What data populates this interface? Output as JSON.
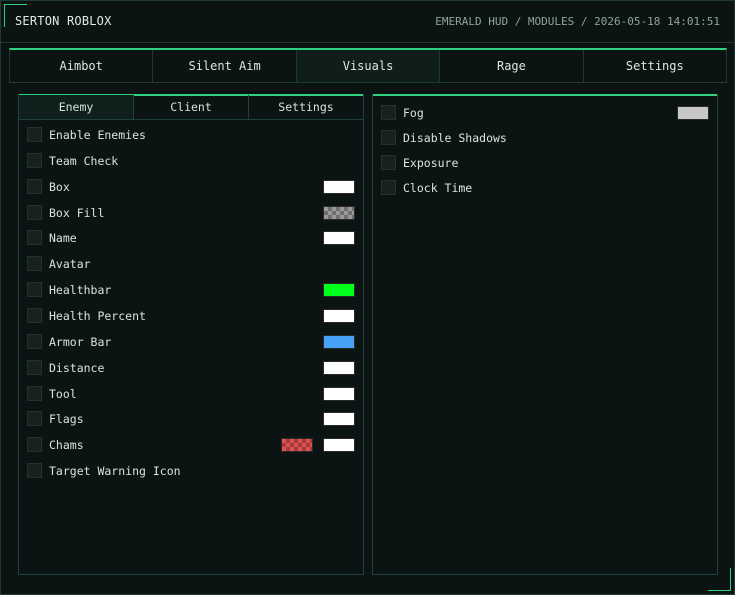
{
  "app": {
    "title": "SERTON ROBLOX",
    "breadcrumb": "EMERALD HUD / MODULES / 2026-05-18 14:01:51"
  },
  "main_tabs": [
    {
      "label": "Aimbot"
    },
    {
      "label": "Silent Aim"
    },
    {
      "label": "Visuals",
      "active": true
    },
    {
      "label": "Rage"
    },
    {
      "label": "Settings"
    }
  ],
  "left_panel": {
    "subtabs": [
      {
        "label": "Enemy",
        "active": true
      },
      {
        "label": "Client"
      },
      {
        "label": "Settings"
      }
    ],
    "options": [
      {
        "label": "Enable Enemies",
        "checked": false
      },
      {
        "label": "Team Check",
        "checked": false
      },
      {
        "label": "Box",
        "checked": false,
        "color": "#ffffff"
      },
      {
        "label": "Box Fill",
        "checked": false,
        "color": "#9a9a9a",
        "pattern": "checker"
      },
      {
        "label": "Name",
        "checked": false,
        "color": "#ffffff"
      },
      {
        "label": "Avatar",
        "checked": false
      },
      {
        "label": "Healthbar",
        "checked": false,
        "color": "#00ff1a"
      },
      {
        "label": "Health Percent",
        "checked": false,
        "color": "#ffffff"
      },
      {
        "label": "Armor Bar",
        "checked": false,
        "color": "#46a2f6"
      },
      {
        "label": "Distance",
        "checked": false,
        "color": "#ffffff"
      },
      {
        "label": "Tool",
        "checked": false,
        "color": "#ffffff"
      },
      {
        "label": "Flags",
        "checked": false,
        "color": "#ffffff"
      },
      {
        "label": "Chams",
        "checked": false,
        "color": "#ffffff",
        "secondary_color": "#e05252",
        "secondary_pattern": "checker"
      },
      {
        "label": "Target Warning Icon",
        "checked": false
      }
    ]
  },
  "right_panel": {
    "options": [
      {
        "label": "Fog",
        "checked": false,
        "color": "#c8c8c8"
      },
      {
        "label": "Disable Shadows",
        "checked": false
      },
      {
        "label": "Exposure",
        "checked": false
      },
      {
        "label": "Clock Time",
        "checked": false
      }
    ]
  },
  "theme": {
    "accent": "#2fd07f",
    "background": "#0b1413"
  }
}
